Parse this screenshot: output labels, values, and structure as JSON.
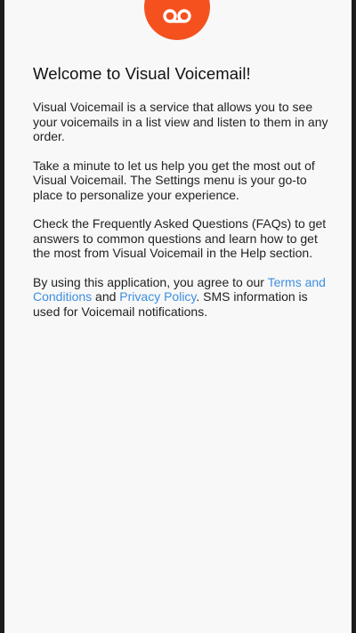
{
  "welcome": {
    "title": "Welcome to Visual Voicemail!",
    "para1": "Visual Voicemail is a service that allows you to see your voicemails in a list view and listen to them in any order.",
    "para2": "Take a minute to let us help you get the most out of Visual Voicemail. The Settings menu is your go-to place to personalize your experience.",
    "para3": "Check the Frequently Asked Questions (FAQs) to get answers to common questions and learn how to get the most from Visual Voicemail in the Help section.",
    "terms": {
      "prefix": "By using this application, you agree to our ",
      "terms_link": "Terms and Conditions",
      "conjunction": " and ",
      "privacy_link": "Privacy Policy",
      "suffix": ". SMS information is used for Voicemail notifications."
    }
  },
  "logo": {
    "icon": "voicemail-icon",
    "color": "#f4511e"
  },
  "colors": {
    "link": "#3d8fe0",
    "background": "#f8f8f8"
  }
}
